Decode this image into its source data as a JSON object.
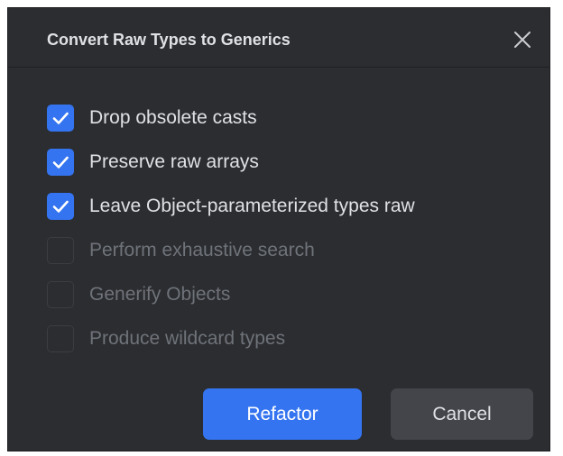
{
  "dialog": {
    "title": "Convert Raw Types to Generics",
    "close_icon": "close-icon"
  },
  "options": [
    {
      "label": "Drop obsolete casts",
      "checked": true,
      "enabled": true
    },
    {
      "label": "Preserve raw arrays",
      "checked": true,
      "enabled": true
    },
    {
      "label": "Leave Object-parameterized types raw",
      "checked": true,
      "enabled": true
    },
    {
      "label": "Perform exhaustive search",
      "checked": false,
      "enabled": false
    },
    {
      "label": "Generify Objects",
      "checked": false,
      "enabled": false
    },
    {
      "label": "Produce wildcard types",
      "checked": false,
      "enabled": false
    }
  ],
  "buttons": {
    "refactor_label": "Refactor",
    "cancel_label": "Cancel"
  },
  "colors": {
    "background": "#2b2d30",
    "accent": "#3574f0",
    "text": "#dfe1e5",
    "disabled_text": "#6f737a",
    "secondary_button": "#43454a"
  }
}
